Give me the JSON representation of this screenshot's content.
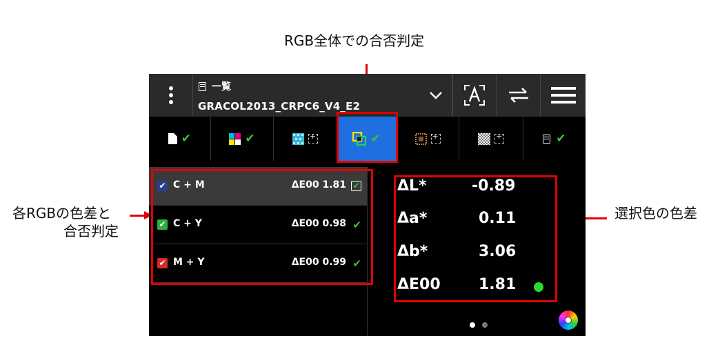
{
  "annotations": {
    "top": "RGB全体での合否判定",
    "left_line1": "各RGBの色差と",
    "left_line2": "合否判定",
    "right": "選択色の色差"
  },
  "header": {
    "list_label": "一覧",
    "profile_name": "GRACOL2013_CRPC6_V4_E2",
    "dropdown_icon": "chevron-down-icon",
    "buttons": [
      "font-scan-icon",
      "swap-arrows-icon",
      "hamburger-menu-icon"
    ]
  },
  "tabs": [
    {
      "icon": "page-icon",
      "status": "✔"
    },
    {
      "icon": "cmyk-patch-icon",
      "status": "✔"
    },
    {
      "icon": "halftone-icon",
      "status": "target"
    },
    {
      "icon": "rgb-overlap-icon",
      "status": "✔",
      "active": true
    },
    {
      "icon": "dotted-square-icon",
      "status": "target"
    },
    {
      "icon": "gradient-pattern-icon",
      "status": "target"
    },
    {
      "icon": "list-icon",
      "status": "✔"
    }
  ],
  "rows": [
    {
      "label": "C + M",
      "value": "ΔE00 1.81",
      "checkbox_color": "#2e3f8f",
      "indicator": "✔",
      "selected": true
    },
    {
      "label": "C + Y",
      "value": "ΔE00 0.98",
      "checkbox_color": "#2fae3b",
      "indicator": "✔",
      "selected": false
    },
    {
      "label": "M + Y",
      "value": "ΔE00 0.99",
      "checkbox_color": "#d32a2a",
      "indicator": "✔",
      "selected": false
    }
  ],
  "stats": [
    {
      "key": "ΔL*",
      "value": "-0.89"
    },
    {
      "key": "Δa*",
      "value": "0.11"
    },
    {
      "key": "Δb*",
      "value": "3.06"
    },
    {
      "key": "ΔE00",
      "value": "1.81"
    }
  ],
  "colors": {
    "accent": "#1f6fe0",
    "check": "#3cc43c",
    "status_ok": "#2ed62e",
    "callout": "#e00000"
  },
  "pager": {
    "pages": 2,
    "current": 1
  }
}
